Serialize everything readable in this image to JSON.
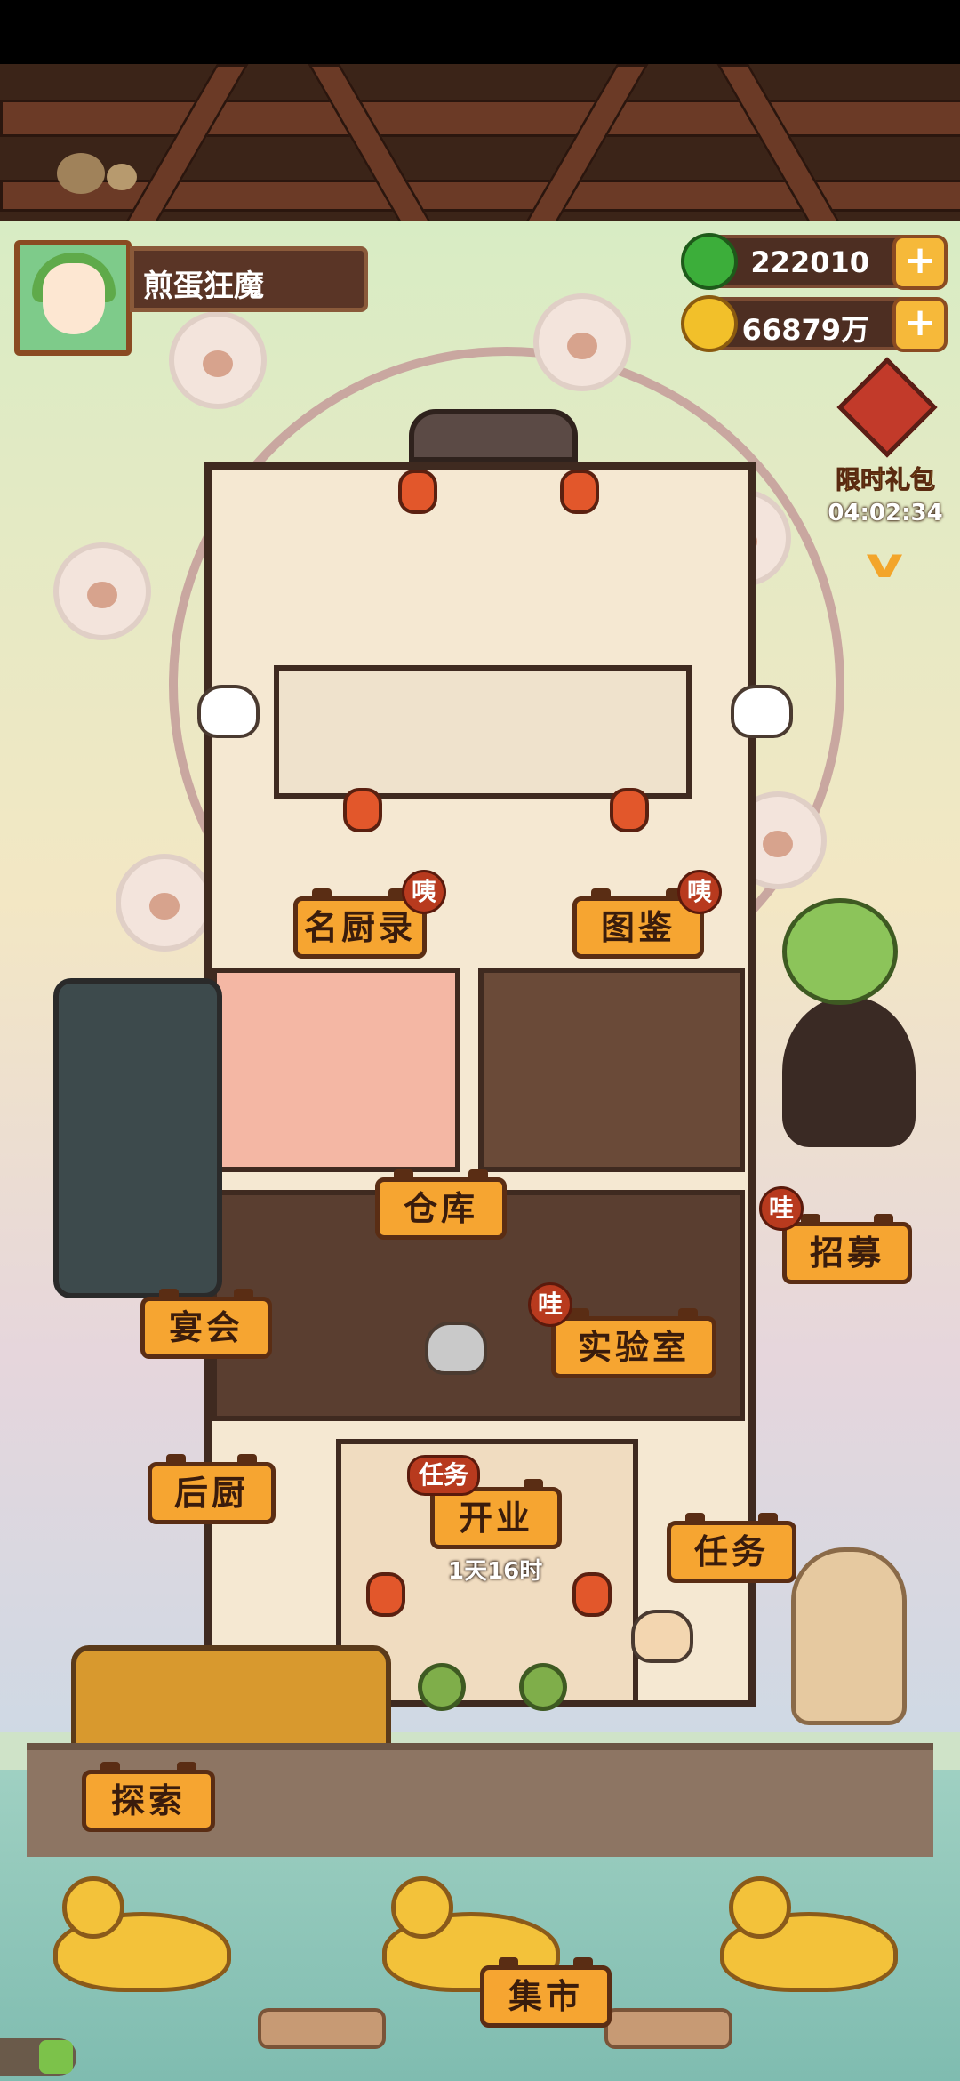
{
  "player": {
    "name": "煎蛋狂魔",
    "avatar_icon": "green-hair-girl-avatar"
  },
  "currencies": [
    {
      "name": "gem",
      "icon": "green-jade-icon",
      "value": "222010"
    },
    {
      "name": "coin",
      "icon": "gold-coin-icon",
      "value": "66879万"
    }
  ],
  "gift": {
    "label": "限时礼包",
    "countdown": "04:02:34"
  },
  "buildings": {
    "chef_list": {
      "label": "名厨录",
      "badge": "咦"
    },
    "catalog": {
      "label": "图鉴",
      "badge": "咦"
    },
    "warehouse": {
      "label": "仓库"
    },
    "recruit": {
      "label": "招募",
      "badge": "哇"
    },
    "banquet": {
      "label": "宴会"
    },
    "lab": {
      "label": "实验室",
      "badge": "哇"
    },
    "kitchen": {
      "label": "后厨"
    },
    "open_business": {
      "label": "开业",
      "tag": "任务",
      "timer": "1天16时"
    },
    "tasks": {
      "label": "任务"
    },
    "explore": {
      "label": "探索"
    },
    "market": {
      "label": "集市"
    }
  },
  "colors": {
    "sign_fill": "#f6a531",
    "sign_border": "#5a2d14",
    "badge_red": "#b83a1e",
    "wood_dark": "#3f2a20"
  }
}
